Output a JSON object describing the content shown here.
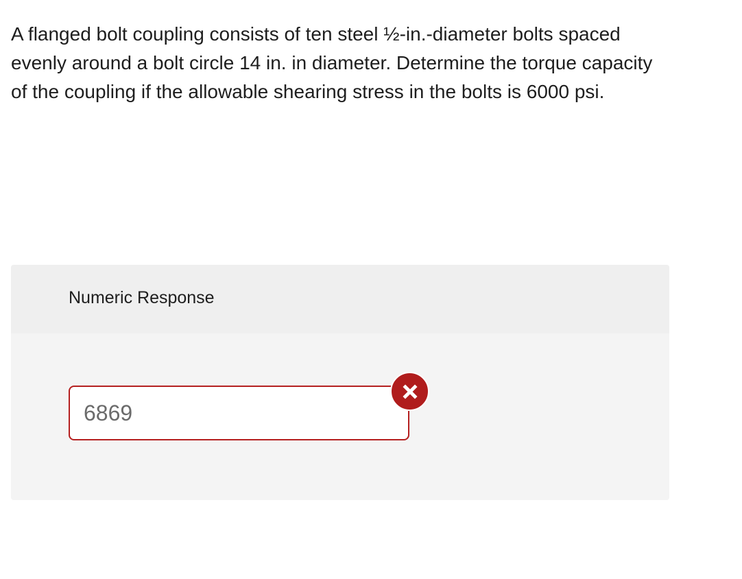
{
  "question": {
    "text": "A flanged bolt coupling consists of ten steel ½-in.-diameter bolts spaced evenly around a bolt circle 14 in. in diameter. Determine the torque capacity of the coupling if the allowable shearing stress in the bolts is 6000 psi."
  },
  "response": {
    "title": "Numeric Response",
    "input_value": "6869",
    "status": "incorrect",
    "status_icon": "close-icon"
  },
  "colors": {
    "incorrect": "#b01c1c",
    "panel_bg": "#f4f4f4",
    "panel_header_bg": "#efefef"
  }
}
